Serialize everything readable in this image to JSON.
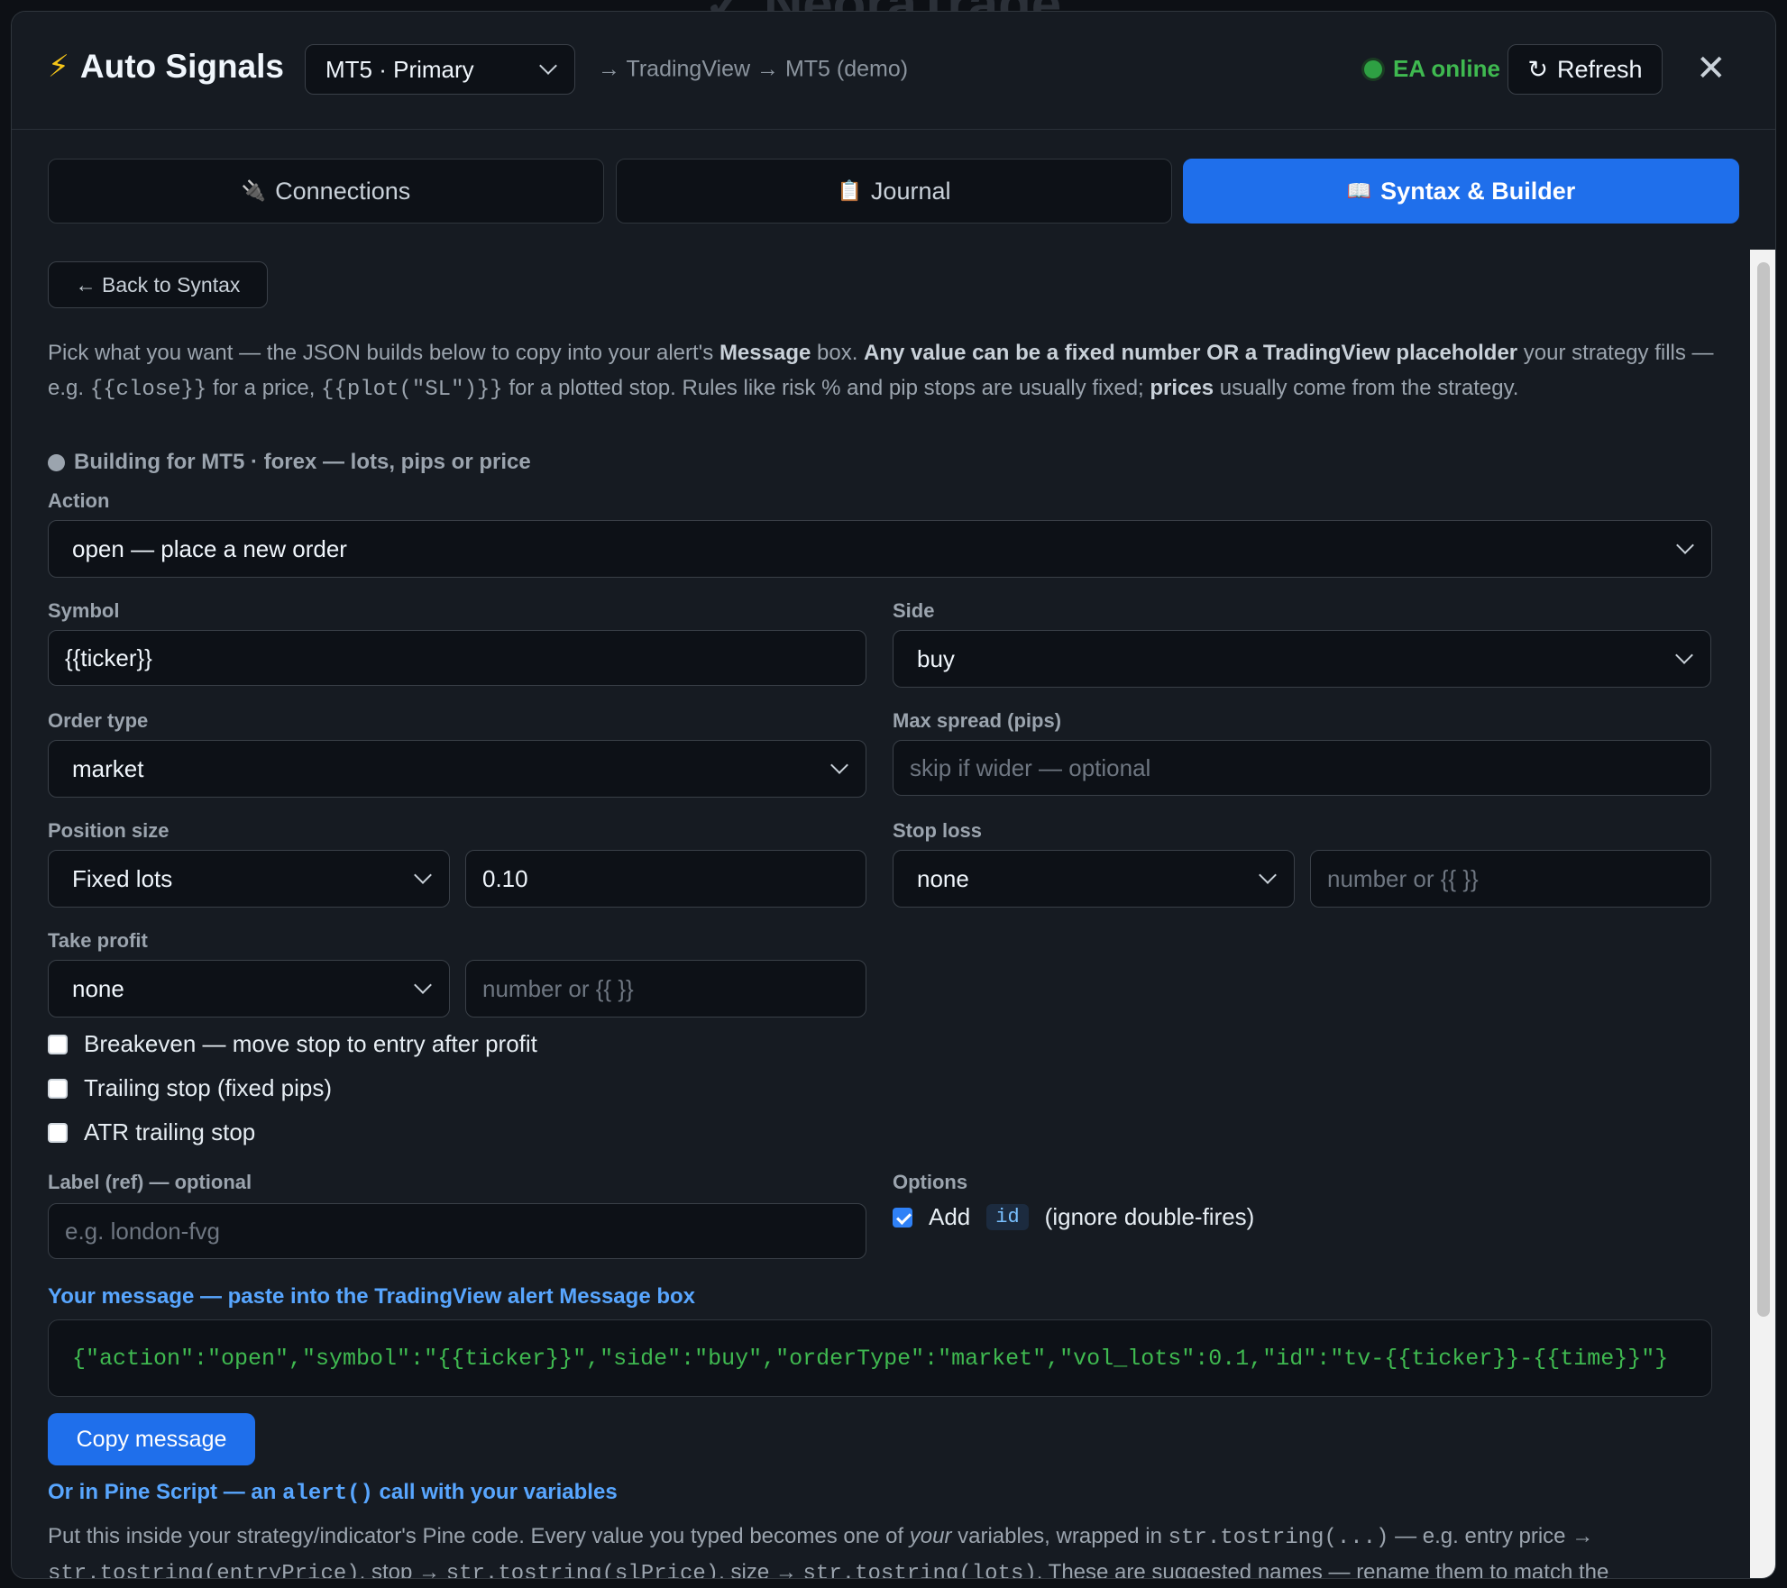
{
  "header": {
    "title": "Auto Signals",
    "account_select": "MT5 · Primary",
    "route": "→ TradingView → MT5 (demo)",
    "status": "EA online",
    "refresh_label": "Refresh",
    "close_label": "✕"
  },
  "tabs": [
    {
      "icon": "🔌",
      "label": "Connections"
    },
    {
      "icon": "📋",
      "label": "Journal"
    },
    {
      "icon": "📖",
      "label": "Syntax & Builder"
    }
  ],
  "back_label": "← Back to Syntax",
  "intro": {
    "p1": "Pick what you want — the JSON builds below to copy into your alert's ",
    "b1": "Message",
    "p2": " box. ",
    "b2": "Any value can be a fixed number OR a TradingView placeholder",
    "p3": " your strategy fills — e.g. ",
    "c1": "{{close}}",
    "p4": " for a price, ",
    "c2": "{{plot(\"SL\")}}",
    "p5": " for a plotted stop. Rules like risk % and pip stops are usually fixed; ",
    "b3": "prices",
    "p6": " usually come from the strategy."
  },
  "building": "Building for MT5 · forex — lots, pips or price",
  "form": {
    "action_label": "Action",
    "action_value": "open — place a new order",
    "symbol_label": "Symbol",
    "symbol_value": "{{ticker}}",
    "side_label": "Side",
    "side_value": "buy",
    "order_type_label": "Order type",
    "order_type_value": "market",
    "max_spread_label": "Max spread (pips)",
    "max_spread_placeholder": "skip if wider — optional",
    "position_size_label": "Position size",
    "position_size_mode": "Fixed lots",
    "position_size_value": "0.10",
    "stop_loss_label": "Stop loss",
    "stop_loss_mode": "none",
    "stop_loss_placeholder": "number or {{ }}",
    "take_profit_label": "Take profit",
    "take_profit_mode": "none",
    "take_profit_placeholder": "number or {{ }}",
    "breakeven_label": "Breakeven — move stop to entry after profit",
    "trailing_label": "Trailing stop (fixed pips)",
    "atr_label": "ATR trailing stop",
    "ref_label": "Label (ref) — optional",
    "ref_placeholder": "e.g. london-fvg",
    "options_label": "Options",
    "opt_add": "Add",
    "opt_id": "id",
    "opt_desc": "(ignore double-fires)"
  },
  "message": {
    "title": "Your message — paste into the TradingView alert Message box",
    "json": "{\"action\":\"open\",\"symbol\":\"{{ticker}}\",\"side\":\"buy\",\"orderType\":\"market\",\"vol_lots\":0.1,\"id\":\"tv-{{ticker}}-{{time}}\"}",
    "copy_label": "Copy message"
  },
  "pine": {
    "title_a": "Or in Pine Script — an ",
    "title_code": "alert()",
    "title_b": " call with your variables",
    "d1": "Put this inside your strategy/indicator's Pine code. Every value you typed becomes one of ",
    "d_em": "your",
    "d2": " variables, wrapped in ",
    "c1": "str.tostring(...)",
    "d3": " — e.g. entry price → ",
    "c2": "str.tostring(entryPrice)",
    "d4": ", stop → ",
    "c3": "str.tostring(slPrice)",
    "d5": ", size → ",
    "c4": "str.tostring(lots)",
    "d6": ". These are suggested names — rename them to match the"
  }
}
